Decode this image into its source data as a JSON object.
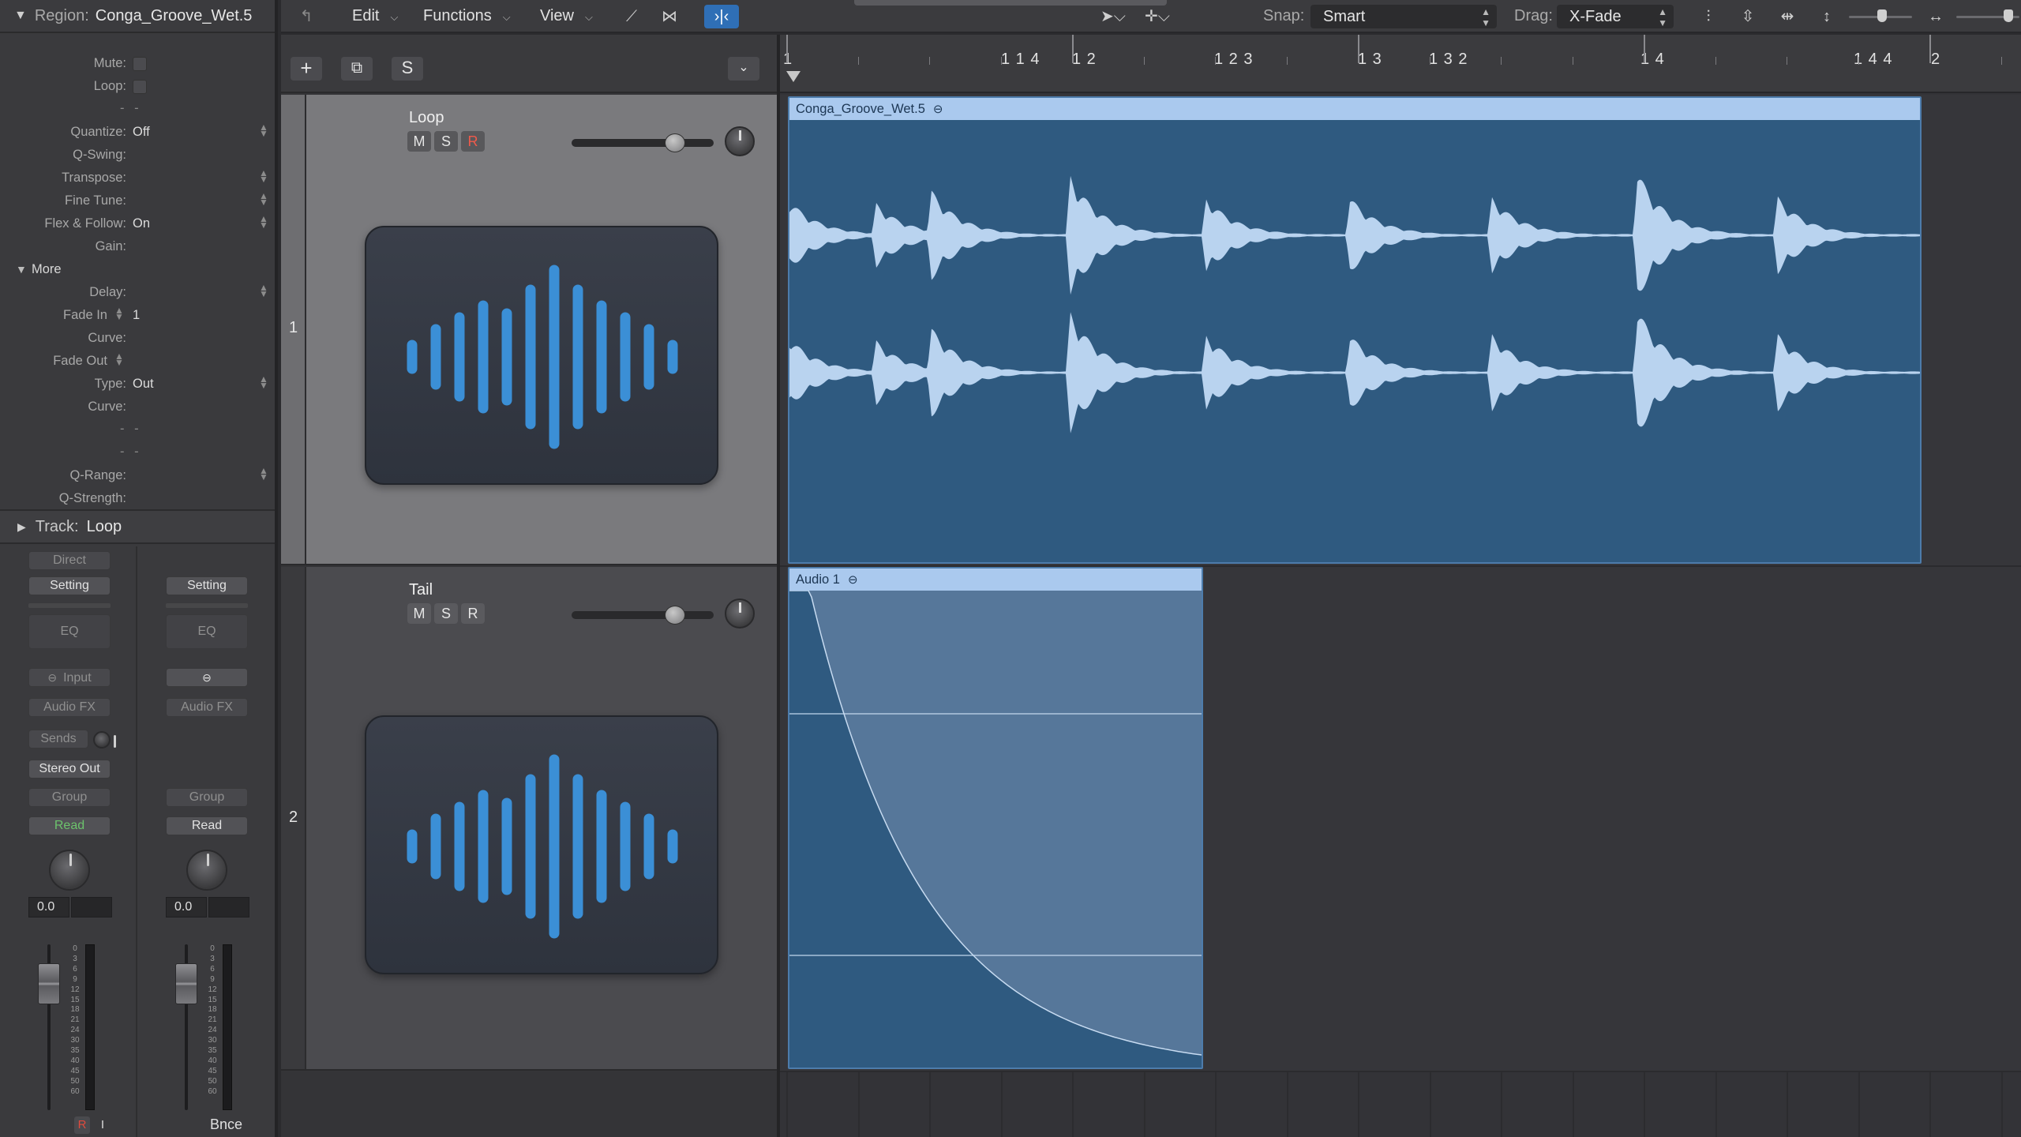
{
  "region": {
    "label": "Region:",
    "name": "Conga_Groove_Wet.5"
  },
  "inspector_params": [
    {
      "label": "Mute:",
      "type": "check"
    },
    {
      "label": "Loop:",
      "type": "check"
    },
    {
      "label": "",
      "type": "dash"
    },
    {
      "label": "Quantize:",
      "value": "Off",
      "step": true
    },
    {
      "label": "Q-Swing:",
      "value": ""
    },
    {
      "label": "Transpose:",
      "value": "",
      "step": true
    },
    {
      "label": "Fine Tune:",
      "value": "",
      "step": true
    },
    {
      "label": "Flex & Follow:",
      "value": "On",
      "step": true
    },
    {
      "label": "Gain:",
      "value": ""
    }
  ],
  "more": {
    "label": "More"
  },
  "more_params": [
    {
      "label": "Delay:",
      "value": "",
      "step": true
    },
    {
      "label": "Fade In",
      "value": "1",
      "fadein": true
    },
    {
      "label": "Curve:",
      "value": ""
    },
    {
      "label": "Fade Out",
      "value": "",
      "fadein": true
    },
    {
      "label": "Type:",
      "value": "Out",
      "step": true
    },
    {
      "label": "Curve:",
      "value": ""
    },
    {
      "label": "",
      "type": "dash"
    },
    {
      "label": "",
      "type": "dash"
    },
    {
      "label": "Q-Range:",
      "value": "",
      "step": true
    },
    {
      "label": "Q-Strength:",
      "value": ""
    }
  ],
  "track_section": {
    "label": "Track:",
    "name": "Loop"
  },
  "strip1": {
    "direct": "Direct",
    "setting": "Setting",
    "eq": "EQ",
    "input": "Input",
    "audio_fx": "Audio FX",
    "sends": "Sends",
    "output": "Stereo Out",
    "group": "Group",
    "automation": "Read",
    "volume": "0.0",
    "r": "R",
    "i": "I"
  },
  "strip2": {
    "setting": "Setting",
    "eq": "EQ",
    "audio_fx": "Audio FX",
    "group": "Group",
    "automation": "Read",
    "volume": "0.0",
    "footer": "Bnce"
  },
  "meter_scale": [
    "0",
    "3",
    "6",
    "9",
    "12",
    "15",
    "18",
    "21",
    "24",
    "30",
    "35",
    "40",
    "45",
    "50",
    "60"
  ],
  "toolbar": {
    "edit": "Edit",
    "functions": "Functions",
    "view": "View",
    "snap_label": "Snap:",
    "snap_value": "Smart",
    "drag_label": "Drag:",
    "drag_value": "X-Fade"
  },
  "header_buttons": {
    "add": "+",
    "s": "S"
  },
  "tracks": [
    {
      "number": "1",
      "name": "Loop",
      "m": "M",
      "s": "S",
      "r": "R",
      "armed": true
    },
    {
      "number": "2",
      "name": "Tail",
      "m": "M",
      "s": "S",
      "r": "R",
      "armed": false
    }
  ],
  "ruler_labels": [
    "1",
    "1 1 4",
    "1 2",
    "1 2 3",
    "1 3",
    "1 3 2",
    "1 4",
    "1 4 4",
    "2"
  ],
  "regions": [
    {
      "name": "Conga_Groove_Wet.5",
      "looped": true
    },
    {
      "name": "Audio 1",
      "looped": true
    }
  ],
  "colors": {
    "region_body": "#2f5a80",
    "region_header": "#aac9ee",
    "waveform": "#b9d3ef",
    "accent_blue": "#2f6fb6",
    "read_green": "#6cc36c",
    "record_red": "#f05a4b"
  },
  "icons": [
    "search-icon",
    "pointer-tool-icon",
    "crosshair-tool-icon",
    "waveform-zoom-icon",
    "vertical-zoom-icon",
    "horizontal-zoom-icon",
    "catch-playhead-icon",
    "automation-icon",
    "flex-icon",
    "link-icon",
    "loop-icon"
  ]
}
